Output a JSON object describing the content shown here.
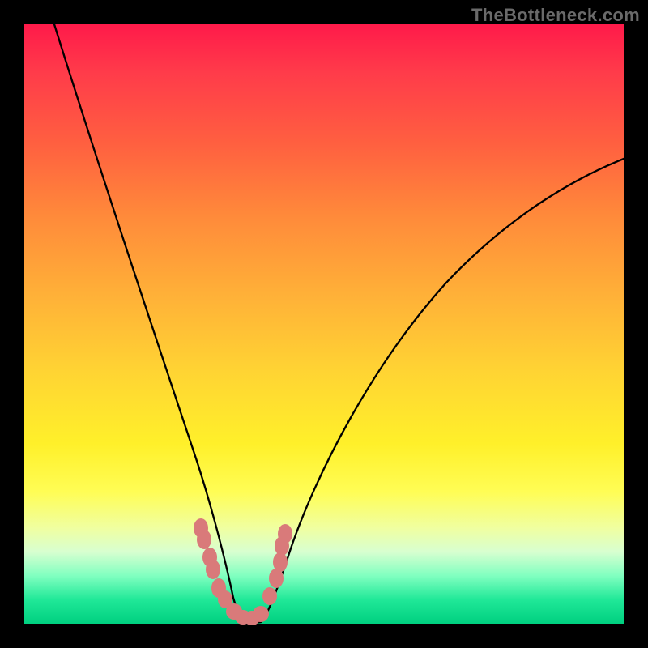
{
  "watermark": "TheBottleneck.com",
  "chart_data": {
    "type": "line",
    "title": "",
    "xlabel": "",
    "ylabel": "",
    "xlim": [
      0,
      100
    ],
    "ylim": [
      0,
      100
    ],
    "series": [
      {
        "name": "left-curve",
        "x": [
          5,
          10,
          15,
          20,
          22,
          24,
          26,
          28,
          30,
          32,
          33,
          34,
          35
        ],
        "y": [
          100,
          80,
          62,
          46,
          40,
          34,
          28,
          22,
          16,
          10,
          7,
          4,
          2
        ]
      },
      {
        "name": "right-curve",
        "x": [
          40,
          42,
          44,
          48,
          55,
          65,
          75,
          85,
          95,
          100
        ],
        "y": [
          2,
          6,
          11,
          20,
          33,
          48,
          58,
          66,
          72,
          75
        ]
      },
      {
        "name": "valley-floor",
        "x": [
          35,
          36,
          37,
          38,
          39,
          40
        ],
        "y": [
          1,
          0.5,
          0.3,
          0.3,
          0.5,
          1
        ]
      }
    ],
    "markers": {
      "name": "threshold-markers",
      "color": "#d97a7a",
      "points": [
        {
          "x": 29.5,
          "y": 16
        },
        {
          "x": 30.0,
          "y": 14
        },
        {
          "x": 31.0,
          "y": 11
        },
        {
          "x": 31.5,
          "y": 9
        },
        {
          "x": 32.5,
          "y": 6
        },
        {
          "x": 33.5,
          "y": 4
        },
        {
          "x": 35.0,
          "y": 2
        },
        {
          "x": 36.5,
          "y": 1
        },
        {
          "x": 38.0,
          "y": 1
        },
        {
          "x": 39.5,
          "y": 2
        },
        {
          "x": 41.0,
          "y": 5
        },
        {
          "x": 42.0,
          "y": 8
        },
        {
          "x": 42.7,
          "y": 11
        },
        {
          "x": 43.0,
          "y": 13
        },
        {
          "x": 43.5,
          "y": 15
        }
      ]
    },
    "gradient_stops": [
      {
        "pos": 0,
        "color": "#ff1a4a"
      },
      {
        "pos": 30,
        "color": "#ff8a3a"
      },
      {
        "pos": 60,
        "color": "#ffd433"
      },
      {
        "pos": 80,
        "color": "#fffd55"
      },
      {
        "pos": 100,
        "color": "#00d080"
      }
    ]
  }
}
